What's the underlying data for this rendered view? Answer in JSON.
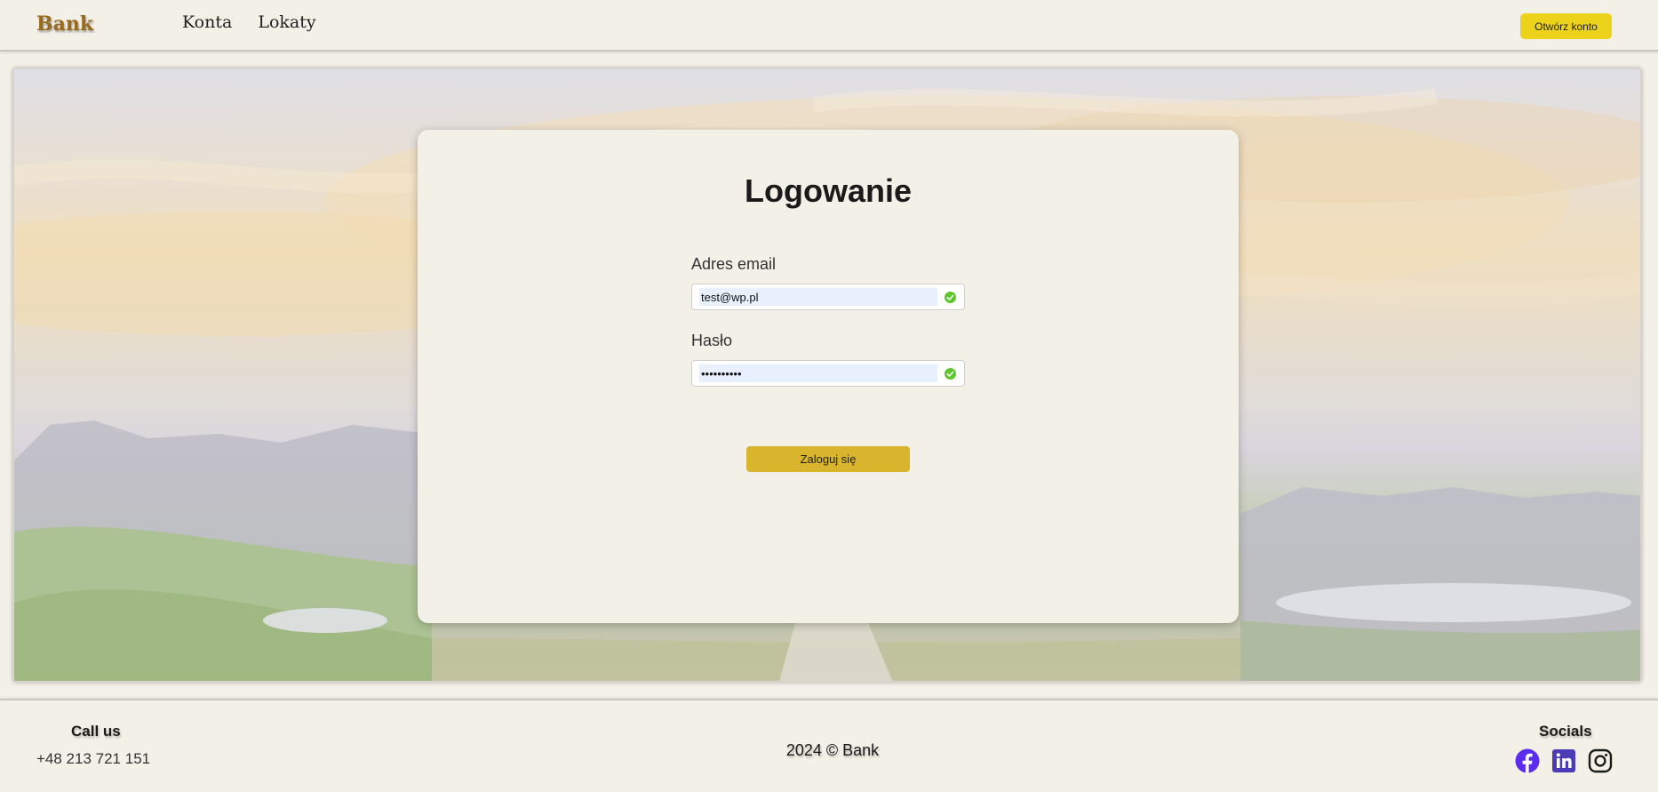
{
  "header": {
    "brand": "Bank",
    "nav": [
      {
        "label": "Konta"
      },
      {
        "label": "Lokaty"
      }
    ],
    "open_account_label": "Otwórz konto"
  },
  "login": {
    "title": "Logowanie",
    "email_label": "Adres email",
    "email_value": "test@wp.pl",
    "password_label": "Hasło",
    "password_value": "••••••••••",
    "submit_label": "Zaloguj się"
  },
  "footer": {
    "call_title": "Call us",
    "phone": "+48 213 721 151",
    "copyright": "2024 © Bank",
    "socials_title": "Socials",
    "social_icons": [
      "facebook-icon",
      "linkedin-icon",
      "instagram-icon"
    ]
  },
  "colors": {
    "accent_yellow": "#edd21b",
    "login_button": "#d8b52c",
    "brand": "#9a6a1c",
    "facebook": "#5b2cf0",
    "linkedin": "#4b3bb6",
    "valid_check": "#5cc72b"
  }
}
